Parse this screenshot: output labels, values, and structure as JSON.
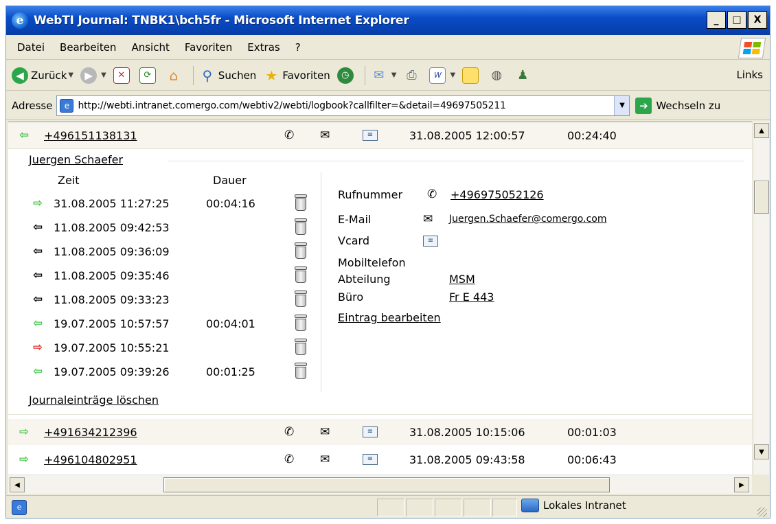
{
  "window": {
    "title": "WebTI Journal: TNBK1\\bch5fr - Microsoft Internet Explorer",
    "ie_icon": "ie-logo-icon",
    "buttons": [
      "_",
      "□",
      "X"
    ]
  },
  "menu": {
    "items": [
      "Datei",
      "Bearbeiten",
      "Ansicht",
      "Favoriten",
      "Extras",
      "?"
    ]
  },
  "toolbar": {
    "back": "Zurück",
    "search": "Suchen",
    "favorites": "Favoriten",
    "links": "Links"
  },
  "address": {
    "label": "Adresse",
    "url": "http://webti.intranet.comergo.com/webtiv2/webti/logbook?callfilter=&detail=49697505211",
    "go": "Wechseln zu"
  },
  "log_rows": [
    {
      "direction": "in",
      "color": "#4cc84c",
      "number": "+496151138131",
      "date": "31.08.2005 12:00:57",
      "duration": "00:24:40"
    },
    {
      "direction": "out",
      "color": "#4cc84c",
      "number": "+491634212396",
      "date": "31.08.2005 10:15:06",
      "duration": "00:01:03"
    },
    {
      "direction": "out",
      "color": "#4cc84c",
      "number": "+496104802951",
      "date": "31.08.2005 09:43:58",
      "duration": "00:06:43"
    }
  ],
  "detail": {
    "contact_name": "Juergen Schaefer",
    "col_time": "Zeit",
    "col_duration": "Dauer",
    "entries": [
      {
        "arrow": "⇨",
        "color": "#4cc84c",
        "date": "31.08.2005 11:27:25",
        "duration": "00:04:16"
      },
      {
        "arrow": "⇦",
        "color": "#000000",
        "date": "11.08.2005 09:42:53",
        "duration": ""
      },
      {
        "arrow": "⇦",
        "color": "#000000",
        "date": "11.08.2005 09:36:09",
        "duration": ""
      },
      {
        "arrow": "⇦",
        "color": "#000000",
        "date": "11.08.2005 09:35:46",
        "duration": ""
      },
      {
        "arrow": "⇦",
        "color": "#000000",
        "date": "11.08.2005 09:33:23",
        "duration": ""
      },
      {
        "arrow": "⇦",
        "color": "#4cc84c",
        "date": "19.07.2005 10:57:57",
        "duration": "00:04:01"
      },
      {
        "arrow": "⇨",
        "color": "#e83030",
        "date": "19.07.2005 10:55:21",
        "duration": ""
      },
      {
        "arrow": "⇦",
        "color": "#4cc84c",
        "date": "19.07.2005 09:39:26",
        "duration": "00:01:25"
      }
    ],
    "delete_link": "Journaleinträge löschen",
    "info": {
      "phone_label": "Rufnummer",
      "phone": "+496975052126",
      "email_label": "E-Mail",
      "email": "Juergen.Schaefer@comergo.com",
      "vcard_label": "Vcard",
      "mobile_label": "Mobiltelefon",
      "department_label": "Abteilung",
      "department": "MSM",
      "office_label": "Büro",
      "office": "Fr E 443",
      "edit_link": "Eintrag bearbeiten"
    }
  },
  "status": {
    "zone": "Lokales Intranet"
  }
}
